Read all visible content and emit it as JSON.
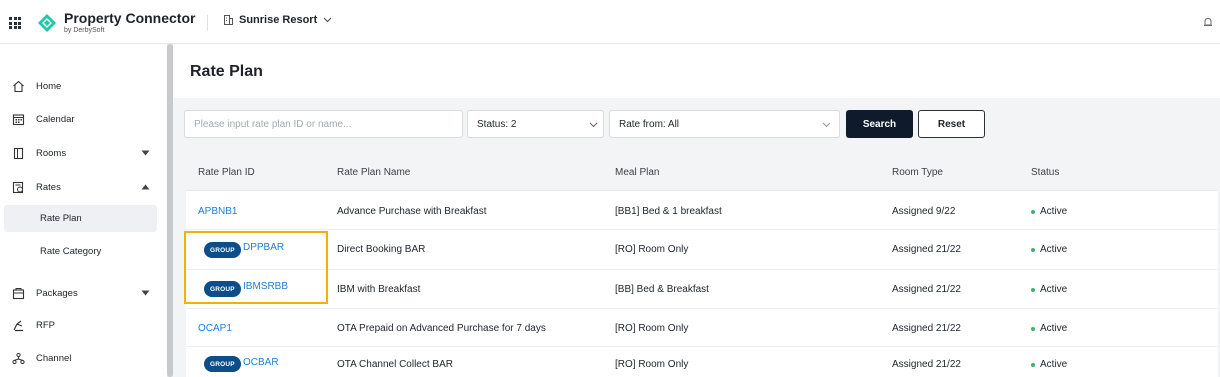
{
  "header": {
    "brand_name": "Property Connector",
    "brand_sub": "by DerbySoft",
    "property": "Sunrise Resort",
    "logo_color": "#1ec9a8"
  },
  "sidebar": {
    "items": [
      {
        "label": "Home",
        "icon": "home-icon"
      },
      {
        "label": "Calendar",
        "icon": "calendar-icon"
      },
      {
        "label": "Rooms",
        "icon": "rooms-icon"
      },
      {
        "label": "Rates",
        "icon": "rates-icon"
      },
      {
        "label": "Packages",
        "icon": "packages-icon"
      },
      {
        "label": "RFP",
        "icon": "rfp-icon"
      },
      {
        "label": "Channel",
        "icon": "channel-icon"
      }
    ],
    "sub_items": [
      {
        "label": "Rate Plan",
        "active": true
      },
      {
        "label": "Rate Category",
        "active": false
      }
    ]
  },
  "page": {
    "title": "Rate Plan"
  },
  "filters": {
    "search_placeholder": "Please input rate plan ID or name...",
    "search_value": "",
    "status_label": "Status: 2",
    "rate_from_label": "Rate from: All",
    "search_button": "Search",
    "reset_button": "Reset"
  },
  "table": {
    "columns": [
      "Rate Plan ID",
      "Rate Plan Name",
      "Meal Plan",
      "Room Type",
      "Status"
    ],
    "group_badge": "GROUP",
    "rows": [
      {
        "id": "APBNB1",
        "group": false,
        "name": "Advance Purchase with Breakfast",
        "meal": "[BB1] Bed & 1 breakfast",
        "room": "Assigned 9/22",
        "status": "Active"
      },
      {
        "id": "DPPBAR",
        "group": true,
        "name": "Direct Booking BAR",
        "meal": "[RO] Room Only",
        "room": "Assigned 21/22",
        "status": "Active"
      },
      {
        "id": "IBMSRBB",
        "group": true,
        "name": "IBM with Breakfast",
        "meal": "[BB] Bed & Breakfast",
        "room": "Assigned 21/22",
        "status": "Active"
      },
      {
        "id": "OCAP1",
        "group": false,
        "name": "OTA Prepaid on Advanced Purchase for 7 days",
        "meal": "[RO] Room Only",
        "room": "Assigned 21/22",
        "status": "Active"
      },
      {
        "id": "OCBAR",
        "group": true,
        "name": "OTA Channel Collect BAR",
        "meal": "[RO] Room Only",
        "room": "Assigned 21/22",
        "status": "Active"
      }
    ]
  },
  "colors": {
    "primary_button": "#0f1b2d",
    "link": "#1d7ed6",
    "group_badge": "#0c4d8a",
    "active_dot": "#3cb371",
    "highlight": "#f0b400"
  }
}
